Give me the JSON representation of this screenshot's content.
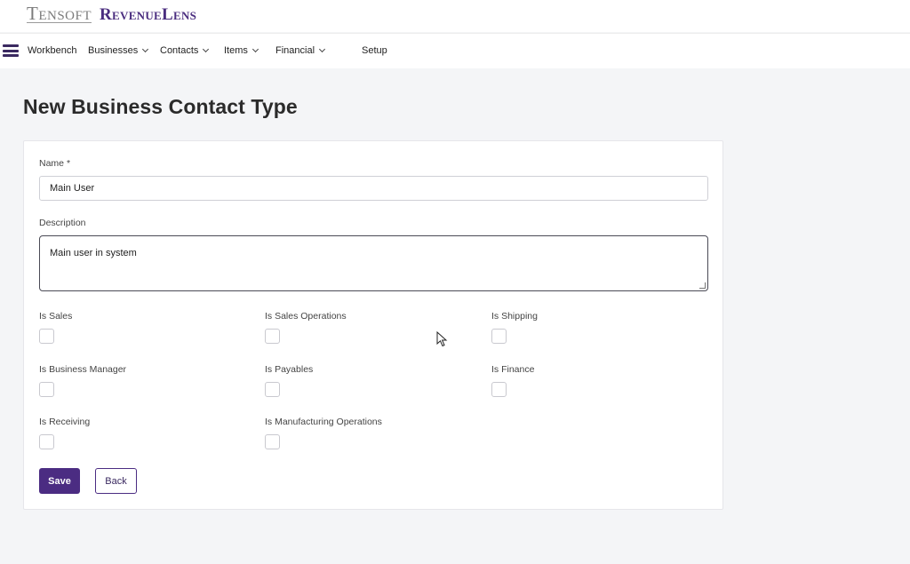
{
  "brand": {
    "company": "Tensoft",
    "product": "RevenueLens"
  },
  "nav": {
    "items": [
      {
        "label": "Workbench",
        "dropdown": false
      },
      {
        "label": "Businesses",
        "dropdown": true
      },
      {
        "label": "Contacts",
        "dropdown": true
      },
      {
        "label": "Items",
        "dropdown": true
      },
      {
        "label": "Financial",
        "dropdown": true
      },
      {
        "label": "Setup",
        "dropdown": false
      }
    ]
  },
  "page": {
    "title": "New Business Contact Type"
  },
  "form": {
    "name_label": "Name",
    "required_marker": "*",
    "name_value": "Main User",
    "description_label": "Description",
    "description_value": "Main user in system",
    "checkboxes": [
      {
        "label": "Is Sales",
        "checked": false
      },
      {
        "label": "Is Sales Operations",
        "checked": false
      },
      {
        "label": "Is Shipping",
        "checked": false
      },
      {
        "label": "Is Business Manager",
        "checked": false
      },
      {
        "label": "Is Payables",
        "checked": false
      },
      {
        "label": "Is Finance",
        "checked": false
      },
      {
        "label": "Is Receiving",
        "checked": false
      },
      {
        "label": "Is Manufacturing Operations",
        "checked": false
      }
    ],
    "save_label": "Save",
    "back_label": "Back"
  },
  "colors": {
    "brand_purple": "#4b2c82",
    "page_bg": "#f4f5f7"
  }
}
